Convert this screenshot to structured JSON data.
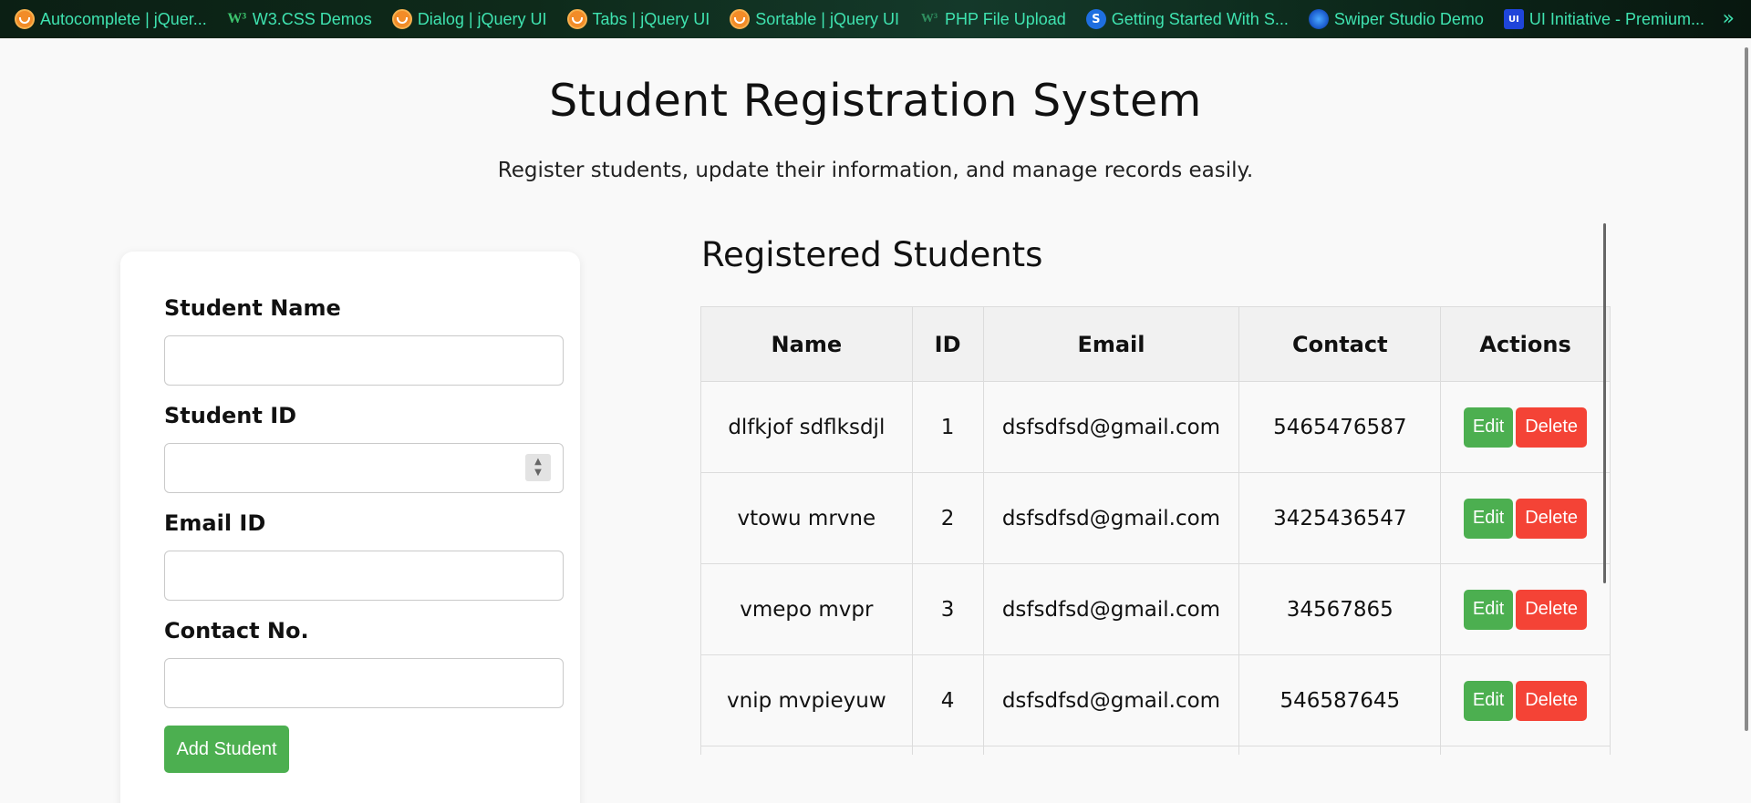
{
  "bookmarks": [
    {
      "icon": "jquery-icon",
      "label": "Autocomplete | jQuer..."
    },
    {
      "icon": "w3-icon",
      "label": "W3.CSS Demos"
    },
    {
      "icon": "jquery-icon",
      "label": "Dialog | jQuery UI"
    },
    {
      "icon": "jquery-icon",
      "label": "Tabs | jQuery UI"
    },
    {
      "icon": "jquery-icon",
      "label": "Sortable | jQuery UI"
    },
    {
      "icon": "php-icon",
      "label": "PHP File Upload"
    },
    {
      "icon": "s-icon",
      "label": "Getting Started With S..."
    },
    {
      "icon": "swiper-icon",
      "label": "Swiper Studio Demo"
    },
    {
      "icon": "ui-icon",
      "label": "UI Initiative - Premium..."
    }
  ],
  "bookmarks_more": "»",
  "header": {
    "title": "Student Registration System",
    "subtitle": "Register students, update their information, and manage records easily."
  },
  "form": {
    "name_label": "Student Name",
    "name_value": "",
    "id_label": "Student ID",
    "id_value": "",
    "email_label": "Email ID",
    "email_value": "",
    "contact_label": "Contact No.",
    "contact_value": "",
    "submit_label": "Add Student"
  },
  "table": {
    "title": "Registered Students",
    "columns": [
      "Name",
      "ID",
      "Email",
      "Contact",
      "Actions"
    ],
    "rows": [
      {
        "name": "dlfkjof sdflksdjl",
        "id": "1",
        "email": "dsfsdfsd@gmail.com",
        "contact": "5465476587"
      },
      {
        "name": "vtowu mrvne",
        "id": "2",
        "email": "dsfsdfsd@gmail.com",
        "contact": "3425436547"
      },
      {
        "name": "vmepo mvpr",
        "id": "3",
        "email": "dsfsdfsd@gmail.com",
        "contact": "34567865"
      },
      {
        "name": "vnip mvpieyuw",
        "id": "4",
        "email": "dsfsdfsd@gmail.com",
        "contact": "546587645"
      }
    ],
    "edit_label": "Edit",
    "delete_label": "Delete"
  },
  "colors": {
    "accent_green": "#4caf50",
    "danger_red": "#f44336",
    "bookmark_text": "#3fe3b0"
  }
}
